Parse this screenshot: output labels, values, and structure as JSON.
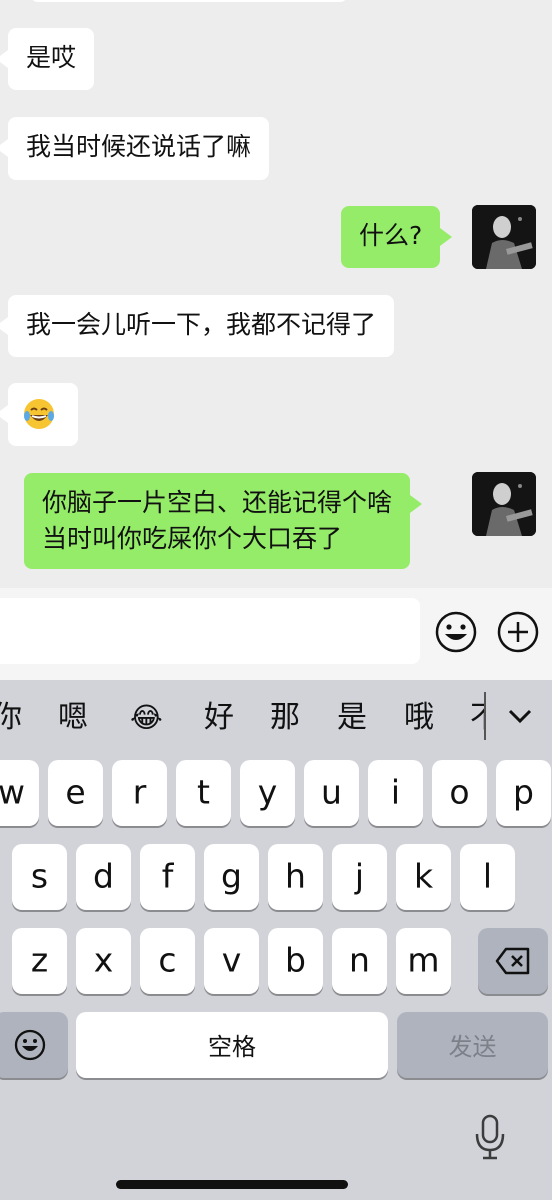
{
  "messages": [
    {
      "side": "left",
      "text": "是哎"
    },
    {
      "side": "left",
      "text": "我当时候还说话了嘛"
    },
    {
      "side": "right",
      "text": "什么?"
    },
    {
      "side": "left",
      "text": "我一会儿听一下，我都不记得了"
    },
    {
      "side": "left",
      "text": "",
      "emoji": "tears-of-joy"
    },
    {
      "side": "right",
      "lines": [
        "你脑子一片空白、还能记得个啥",
        "当时叫你吃屎你个大口吞了"
      ]
    }
  ],
  "input": {
    "value": "",
    "emoji_button": "smiley-icon",
    "plus_button": "plus-icon"
  },
  "candidates": [
    "你",
    "嗯",
    "😂",
    "好",
    "那",
    "是",
    "哦",
    "不"
  ],
  "keyboard": {
    "row1": [
      "w",
      "e",
      "r",
      "t",
      "y",
      "u",
      "i",
      "o",
      "p"
    ],
    "row2": [
      "s",
      "d",
      "f",
      "g",
      "h",
      "j",
      "k",
      "l"
    ],
    "row3": [
      "z",
      "x",
      "c",
      "v",
      "b",
      "n",
      "m"
    ],
    "space": "空格",
    "send": "发送",
    "emoji_key": "emoji-icon",
    "delete_key": "backspace-icon",
    "mic": "microphone-icon"
  },
  "colors": {
    "sent_bubble": "#95ec69",
    "received_bubble": "#ffffff",
    "chat_bg": "#ededed",
    "keyboard_bg": "#d1d3d9"
  }
}
